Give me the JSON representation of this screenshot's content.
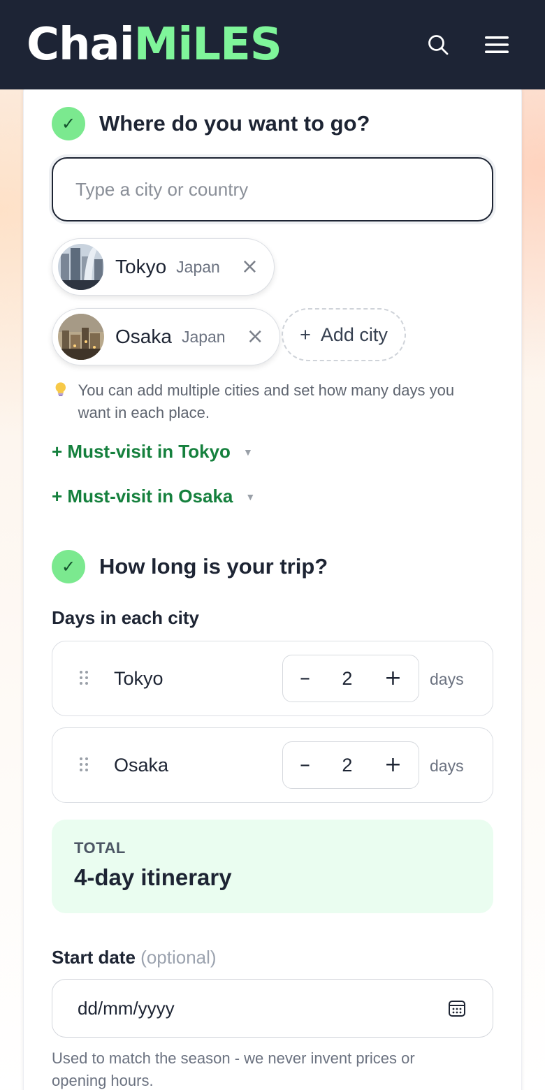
{
  "header": {
    "logo_part1": "Chai",
    "logo_part2": "MiLES",
    "search_icon": "search-icon",
    "menu_icon": "menu-icon"
  },
  "destination": {
    "title": "Where do you want to go?",
    "input_placeholder": "Type a city or country",
    "input_value": "",
    "cities": [
      {
        "city": "Tokyo",
        "country": "Japan"
      },
      {
        "city": "Osaka",
        "country": "Japan"
      }
    ],
    "add_city_label": "Add city",
    "tip": "You can add multiple cities and set how many days you want in each place.",
    "must_visit": [
      "+ Must-visit in Tokyo",
      "+ Must-visit in Osaka"
    ]
  },
  "duration": {
    "title": "How long is your trip?",
    "subtitle": "Days in each city",
    "rows": [
      {
        "city": "Tokyo",
        "days": "2",
        "unit": "days"
      },
      {
        "city": "Osaka",
        "days": "2",
        "unit": "days"
      }
    ],
    "total_label": "TOTAL",
    "total_value": "4-day itinerary"
  },
  "start_date": {
    "label": "Start date",
    "optional": "(optional)",
    "placeholder": "dd/mm/yyyy",
    "help": "Used to match the season - we never invent prices or opening hours."
  },
  "colors": {
    "header_bg": "#1d2435",
    "accent_green": "#7ff59a",
    "link_green": "#15803d",
    "total_bg": "#eafdf0"
  }
}
